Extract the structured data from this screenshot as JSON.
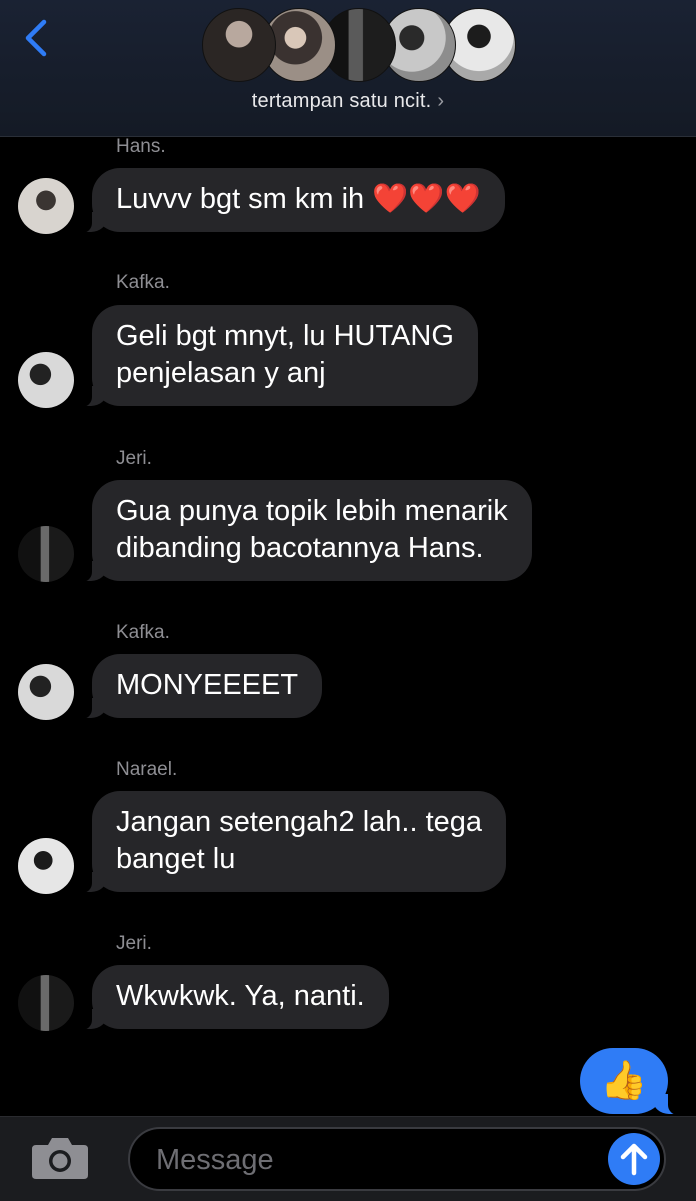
{
  "header": {
    "group_name": "tertampan satu ncit.",
    "chevron": "›",
    "back_icon": "chevron-left-icon",
    "member_avatars": [
      "avatar-1",
      "avatar-2",
      "avatar-3",
      "avatar-4",
      "avatar-5"
    ]
  },
  "messages": [
    {
      "sender": "Hans.",
      "text": "Luvvv bgt sm km ih",
      "emoji": "❤️❤️❤️"
    },
    {
      "sender": "Kafka.",
      "line1": "Geli bgt mnyt, lu HUTANG",
      "line2": "penjelasan y anj"
    },
    {
      "sender": "Jeri.",
      "line1": "Gua punya topik lebih menarik",
      "line2": "dibanding bacotannya Hans."
    },
    {
      "sender": "Kafka.",
      "text": "MONYEEEET"
    },
    {
      "sender": "Narael.",
      "line1": "Jangan setengah2 lah.. tega",
      "line2": "banget lu"
    },
    {
      "sender": "Jeri.",
      "text": "Wkwkwk. Ya, nanti."
    }
  ],
  "outgoing": {
    "emoji": "👍"
  },
  "input": {
    "placeholder": "Message",
    "camera_icon": "camera-icon",
    "send_icon": "arrow-up-icon"
  },
  "colors": {
    "incoming_bubble": "#262629",
    "outgoing_bubble": "#2f7cf6",
    "sender_label": "#8e8e93",
    "accent": "#2f7cf6"
  }
}
